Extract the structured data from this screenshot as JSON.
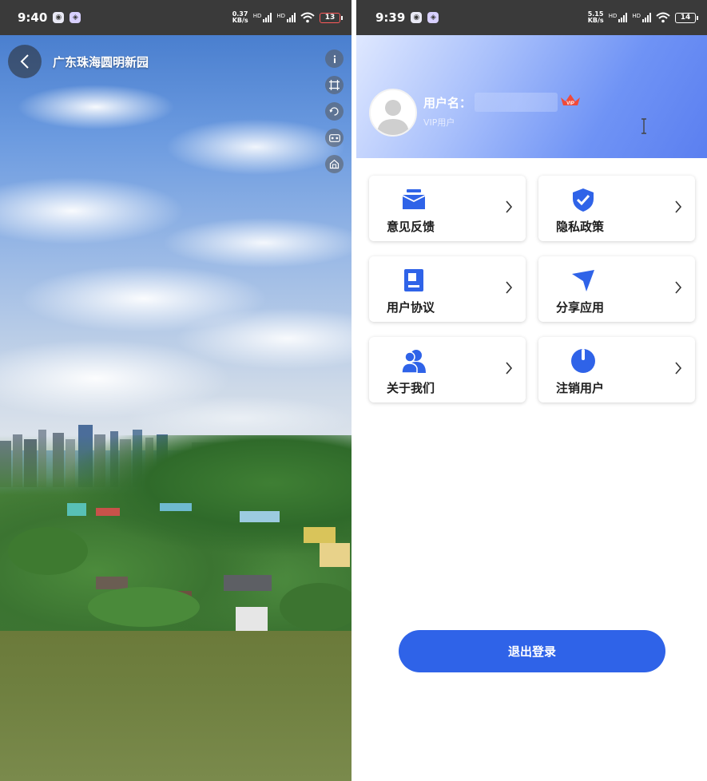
{
  "left_screen": {
    "statusbar": {
      "time": "9:40",
      "net_speed_value": "0.37",
      "net_speed_unit": "KB/s",
      "hd_label_1": "HD",
      "hd_label_2": "HD",
      "battery": "13"
    },
    "title": "广东珠海圆明新园",
    "icons": [
      "back-arrow-icon",
      "info-icon",
      "crop-icon",
      "rotate-icon",
      "vr-icon",
      "home-icon"
    ]
  },
  "right_screen": {
    "statusbar": {
      "time": "9:39",
      "net_speed_value": "5.15",
      "net_speed_unit": "KB/s",
      "hd_label_1": "HD",
      "hd_label_2": "HD",
      "battery": "14"
    },
    "profile": {
      "username_label": "用户名：",
      "vip_badge": "VIP",
      "member_type": "VIP用户"
    },
    "menu": [
      {
        "label": "意见反馈",
        "icon": "feedback-mail-icon"
      },
      {
        "label": "隐私政策",
        "icon": "shield-check-icon"
      },
      {
        "label": "用户协议",
        "icon": "document-icon"
      },
      {
        "label": "分享应用",
        "icon": "send-icon"
      },
      {
        "label": "关于我们",
        "icon": "users-icon"
      },
      {
        "label": "注销用户",
        "icon": "power-icon"
      }
    ],
    "logout_label": "退出登录"
  },
  "colors": {
    "accent": "#2f63e8",
    "icon_blue": "#2f63e8",
    "statusbar": "#3a3a3a"
  }
}
